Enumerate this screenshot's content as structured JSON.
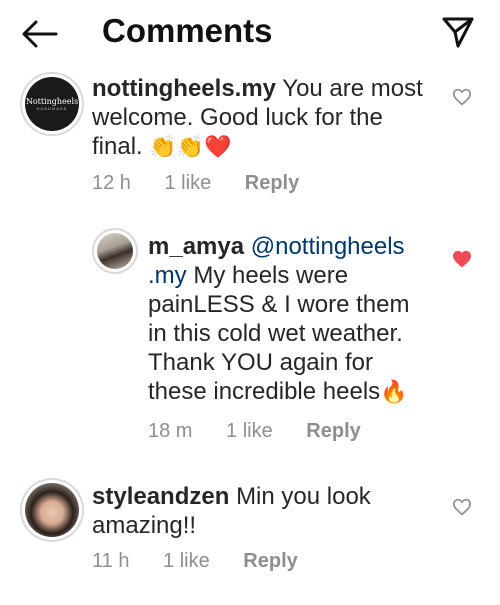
{
  "header": {
    "title": "Comments"
  },
  "comments": [
    {
      "username": "nottingheels.my",
      "text_line1": "You are most",
      "text_line2": "welcome. Good luck for the",
      "text_line3": "final.",
      "emoji": "👏👏❤️",
      "avatar_brand": "Nottingheels",
      "avatar_sub": "HANDMADE",
      "time": "12 h",
      "likes": "1 like",
      "reply": "Reply",
      "liked": false
    },
    {
      "username": "m_amya",
      "mention_line1": "@nottingheels",
      "mention_line2": ".my",
      "text_line1": "My heels were",
      "text_line2": "painLESS & I wore them",
      "text_line3": "in this cold wet weather.",
      "text_line4": "Thank YOU again for",
      "text_line5": "these incredible heels",
      "emoji": "🔥",
      "time": "18 m",
      "likes": "1 like",
      "reply": "Reply",
      "liked": true
    },
    {
      "username": "styleandzen",
      "text_line1": "Min you look",
      "text_line2": "amazing!!",
      "time": "11 h",
      "likes": "1 like",
      "reply": "Reply",
      "liked": false
    }
  ],
  "colors": {
    "liked_heart": "#ed4956",
    "muted_text": "#8e8e8e",
    "mention": "#00376b"
  }
}
